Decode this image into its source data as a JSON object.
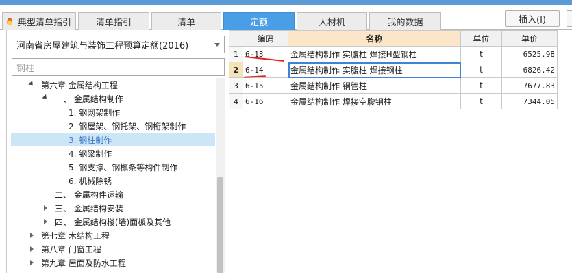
{
  "tabs": [
    {
      "label": "典型清单指引",
      "active": false
    },
    {
      "label": "清单指引",
      "active": false
    },
    {
      "label": "清单",
      "active": false
    },
    {
      "label": "定额",
      "active": true
    },
    {
      "label": "人材机",
      "active": false
    },
    {
      "label": "我的数据",
      "active": false
    }
  ],
  "toolbar": {
    "insert_label": "插入(I)"
  },
  "quota_selector": {
    "value": "河南省房屋建筑与装饰工程预算定额(2016)"
  },
  "search": {
    "placeholder": "钢柱"
  },
  "tree": [
    {
      "label": "第六章  金属结构工程",
      "level": 1,
      "expanded": true
    },
    {
      "label": "一、  金属结构制作",
      "level": 2,
      "expanded": true
    },
    {
      "label": "1. 钢网架制作",
      "level": 3
    },
    {
      "label": "2. 钢屋架、钢托架、钢桁架制作",
      "level": 3
    },
    {
      "label": "3. 钢柱制作",
      "level": 3,
      "selected": true
    },
    {
      "label": "4. 钢梁制作",
      "level": 3
    },
    {
      "label": "5. 钢支撑、钢檩条等构件制作",
      "level": 3
    },
    {
      "label": "6. 机械除锈",
      "level": 3
    },
    {
      "label": "二、  金属构件运输",
      "level": 2
    },
    {
      "label": "三、  金属结构安装",
      "level": 2,
      "collapsed": true
    },
    {
      "label": "四、  金属结构楼(墙)面板及其他",
      "level": 2,
      "collapsed": true
    },
    {
      "label": "第七章  木结构工程",
      "level": 1,
      "collapsed": true
    },
    {
      "label": "第八章  门窗工程",
      "level": 1,
      "collapsed": true
    },
    {
      "label": "第九章  屋面及防水工程",
      "level": 1,
      "collapsed": true
    }
  ],
  "table": {
    "headers": {
      "code": "编码",
      "name": "名称",
      "unit": "单位",
      "price": "单价"
    },
    "rows": [
      {
        "num": "1",
        "code": "6-13",
        "name": "金属结构制作 实腹柱 焊接H型钢柱",
        "unit": "t",
        "price": "6525.98"
      },
      {
        "num": "2",
        "code": "6-14",
        "name": "金属结构制作 实腹柱 焊接钢柱",
        "unit": "t",
        "price": "6826.42"
      },
      {
        "num": "3",
        "code": "6-15",
        "name": "金属结构制作 钢管柱",
        "unit": "t",
        "price": "7677.83"
      },
      {
        "num": "4",
        "code": "6-16",
        "name": "金属结构制作 焊接空腹钢柱",
        "unit": "t",
        "price": "7344.05"
      }
    ]
  },
  "colors": {
    "accent": "#4a9ee6",
    "selected_row": "#cde6f7",
    "annotation": "#e0221d"
  }
}
